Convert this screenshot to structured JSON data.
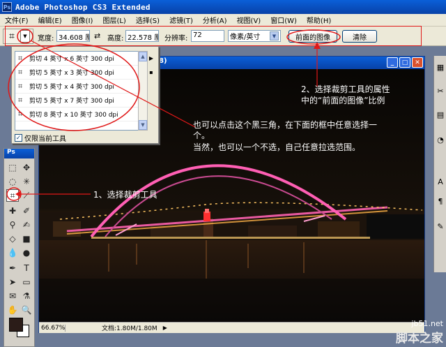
{
  "app": {
    "title": "Adobe Photoshop CS3 Extended",
    "logo": "Ps"
  },
  "menu": [
    {
      "label": "文件(F)"
    },
    {
      "label": "编辑(E)"
    },
    {
      "label": "图像(I)"
    },
    {
      "label": "图层(L)"
    },
    {
      "label": "选择(S)"
    },
    {
      "label": "滤镜(T)"
    },
    {
      "label": "分析(A)"
    },
    {
      "label": "视图(V)"
    },
    {
      "label": "窗口(W)"
    },
    {
      "label": "帮助(H)"
    }
  ],
  "options": {
    "width_label": "宽度:",
    "width_value": "34.608 厘",
    "height_label": "高度:",
    "height_value": "22.578 厘",
    "resolution_label": "分辨率:",
    "resolution_value": "72",
    "unit_value": "像素/英寸",
    "front_image_label": "前面的图像",
    "clear_label": "清除",
    "swap_icon": "swap-arrows-icon"
  },
  "presets": {
    "items": [
      {
        "label": "剪切 4 英寸 x 6 英寸 300 dpi"
      },
      {
        "label": "剪切 5 英寸 x 3 英寸 300 dpi"
      },
      {
        "label": "剪切 5 英寸 x 4 英寸 300 dpi"
      },
      {
        "label": "剪切 5 英寸 x 7 英寸 300 dpi"
      },
      {
        "label": "剪切 8 英寸 x 10 英寸 300 dpi"
      }
    ],
    "current_only_label": "仅限当前工具",
    "current_only_checked": true
  },
  "document": {
    "title_suffix": "8)",
    "zoom": "66.67%",
    "doc_size": "文档:1.80M/1.80M"
  },
  "toolbox": {
    "header": "Ps"
  },
  "annotations": {
    "step1": "1、选择裁剪工具",
    "step2_line1": "2、选择裁剪工具的属性",
    "step2_line2": "中的“前面的图像”比例",
    "note_line1": "也可以点击这个黑三角，在下面的框中任意选择一",
    "note_line2": "个。",
    "note_line3": "当然，也可以一个不选，自己任意拉选范围。"
  },
  "watermark": {
    "site": "jb51.net",
    "name": "脚本之家"
  },
  "colors": {
    "accent_blue": "#0a5fd8",
    "annotation_red": "#e01818",
    "foreground_swatch": "#2b1c18",
    "background_swatch": "#ffffff",
    "bridge_light": "#ff5fb4"
  }
}
